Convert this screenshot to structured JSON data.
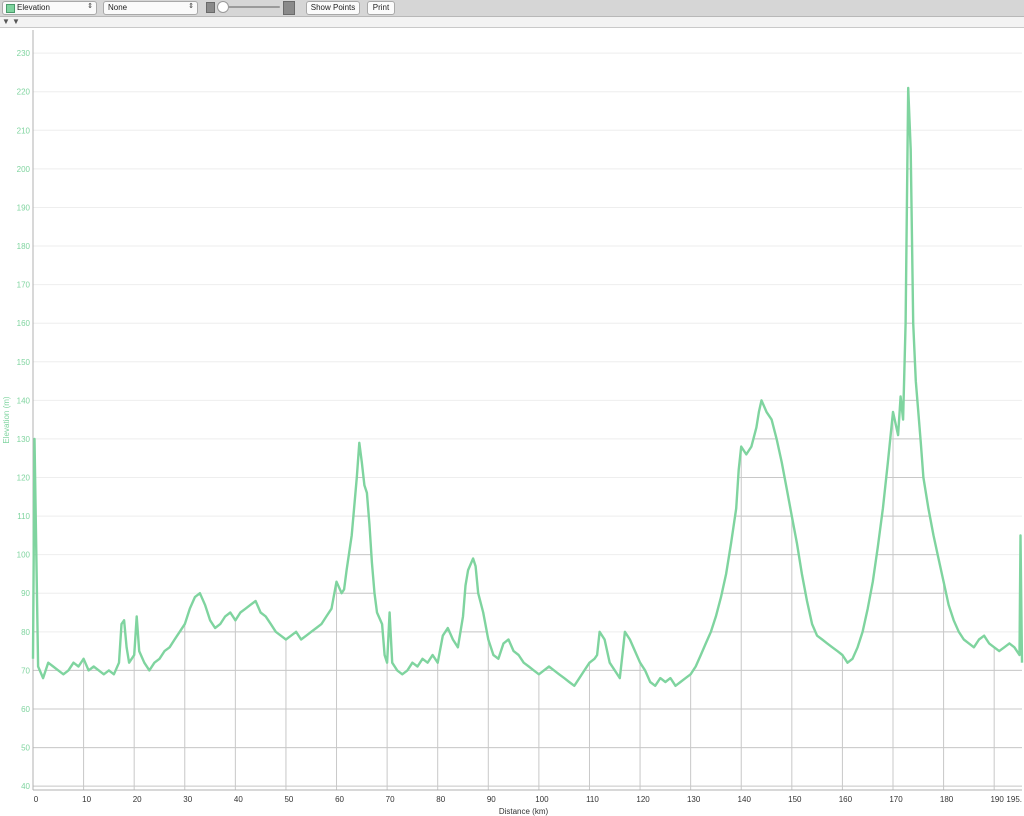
{
  "toolbar": {
    "series_select": "Elevation",
    "compare_select": "None",
    "show_points_label": "Show Points",
    "print_label": "Print",
    "zoom_level": 0
  },
  "colors": {
    "series": "#7fd49f",
    "grid": "#c8c8c8",
    "axis_text": "#7fd49f"
  },
  "chart_data": {
    "type": "line",
    "xlabel": "Distance (km)",
    "ylabel": "Elevation (m)",
    "xlim": [
      0,
      195.5
    ],
    "ylim": [
      39,
      236
    ],
    "xticks": [
      0,
      10,
      20,
      30,
      40,
      50,
      60,
      70,
      80,
      90,
      100,
      110,
      120,
      130,
      140,
      150,
      160,
      170,
      180,
      190
    ],
    "xtick_labels": [
      "0",
      "10",
      "20",
      "30",
      "40",
      "50",
      "60",
      "70",
      "80",
      "90",
      "100",
      "110",
      "120",
      "130",
      "140",
      "150",
      "160",
      "170",
      "180",
      "190",
      "195."
    ],
    "yticks": [
      40,
      50,
      60,
      70,
      80,
      90,
      100,
      110,
      120,
      130,
      140,
      150,
      160,
      170,
      180,
      190,
      200,
      210,
      220,
      230
    ],
    "grid": true,
    "series": [
      {
        "x": [
          0,
          0.3,
          1,
          2,
          3,
          4,
          5,
          6,
          7,
          8,
          9,
          10,
          11,
          12,
          13,
          14,
          15,
          16,
          17,
          17.5,
          18,
          18.5,
          19,
          20,
          20.5,
          21,
          22,
          23,
          24,
          25,
          26,
          27,
          28,
          29,
          30,
          31,
          32,
          33,
          34,
          35,
          36,
          37,
          38,
          39,
          40,
          41,
          42,
          43,
          44,
          45,
          46,
          47,
          48,
          49,
          50,
          51,
          52,
          53,
          54,
          55,
          56,
          57,
          58,
          59,
          60,
          61,
          61.5,
          62,
          63,
          64,
          64.5,
          65,
          65.5,
          66,
          66.5,
          67,
          67.5,
          68,
          69,
          69.5,
          70,
          70.5,
          71,
          72,
          73,
          74,
          75,
          76,
          77,
          78,
          79,
          80,
          81,
          82,
          83,
          84,
          85,
          85.5,
          86,
          87,
          87.5,
          88,
          89,
          90,
          91,
          92,
          93,
          94,
          95,
          96,
          97,
          98,
          99,
          100,
          101,
          102,
          103,
          104,
          105,
          106,
          107,
          108,
          109,
          110,
          111,
          111.5,
          112,
          113,
          114,
          115,
          116,
          116.5,
          117,
          118,
          119,
          120,
          121,
          122,
          123,
          124,
          125,
          126,
          127,
          128,
          129,
          130,
          131,
          132,
          133,
          134,
          135,
          136,
          137,
          138,
          139,
          139.5,
          140,
          141,
          142,
          143,
          143.5,
          144,
          145,
          146,
          147,
          148,
          149,
          150,
          151,
          152,
          153,
          154,
          155,
          156,
          157,
          158,
          159,
          160,
          161,
          162,
          163,
          164,
          165,
          166,
          167,
          168,
          169,
          170,
          171,
          171.5,
          172,
          172.5,
          173,
          173.5,
          174,
          174.5,
          175,
          175.5,
          176,
          177,
          178,
          179,
          180,
          181,
          182,
          183,
          184,
          185,
          186,
          187,
          188,
          189,
          190,
          191,
          192,
          193,
          194,
          195,
          195.2,
          195.5
        ],
        "values": [
          73,
          130,
          71,
          68,
          72,
          71,
          70,
          69,
          70,
          72,
          71,
          73,
          70,
          71,
          70,
          69,
          70,
          69,
          72,
          82,
          83,
          76,
          72,
          74,
          84,
          75,
          72,
          70,
          72,
          73,
          75,
          76,
          78,
          80,
          82,
          86,
          89,
          90,
          87,
          83,
          81,
          82,
          84,
          85,
          83,
          85,
          86,
          87,
          88,
          85,
          84,
          82,
          80,
          79,
          78,
          79,
          80,
          78,
          79,
          80,
          81,
          82,
          84,
          86,
          93,
          90,
          91,
          96,
          105,
          120,
          129,
          124,
          118,
          116,
          108,
          98,
          90,
          85,
          82,
          74,
          72,
          85,
          72,
          70,
          69,
          70,
          72,
          71,
          73,
          72,
          74,
          72,
          79,
          81,
          78,
          76,
          84,
          92,
          96,
          99,
          97,
          90,
          85,
          78,
          74,
          73,
          77,
          78,
          75,
          74,
          72,
          71,
          70,
          69,
          70,
          71,
          70,
          69,
          68,
          67,
          66,
          68,
          70,
          72,
          73,
          74,
          80,
          78,
          72,
          70,
          68,
          74,
          80,
          78,
          75,
          72,
          70,
          67,
          66,
          68,
          67,
          68,
          66,
          67,
          68,
          69,
          71,
          74,
          77,
          80,
          84,
          89,
          95,
          103,
          112,
          122,
          128,
          126,
          128,
          133,
          137,
          140,
          137,
          135,
          130,
          124,
          117,
          110,
          103,
          95,
          88,
          82,
          79,
          78,
          77,
          76,
          75,
          74,
          72,
          73,
          76,
          80,
          86,
          93,
          102,
          112,
          124,
          137,
          131,
          141,
          135,
          160,
          221,
          205,
          160,
          145,
          137,
          129,
          120,
          112,
          105,
          99,
          93,
          87,
          83,
          80,
          78,
          77,
          76,
          78,
          79,
          77,
          76,
          75,
          76,
          77,
          76,
          74,
          105,
          72
        ]
      }
    ]
  }
}
